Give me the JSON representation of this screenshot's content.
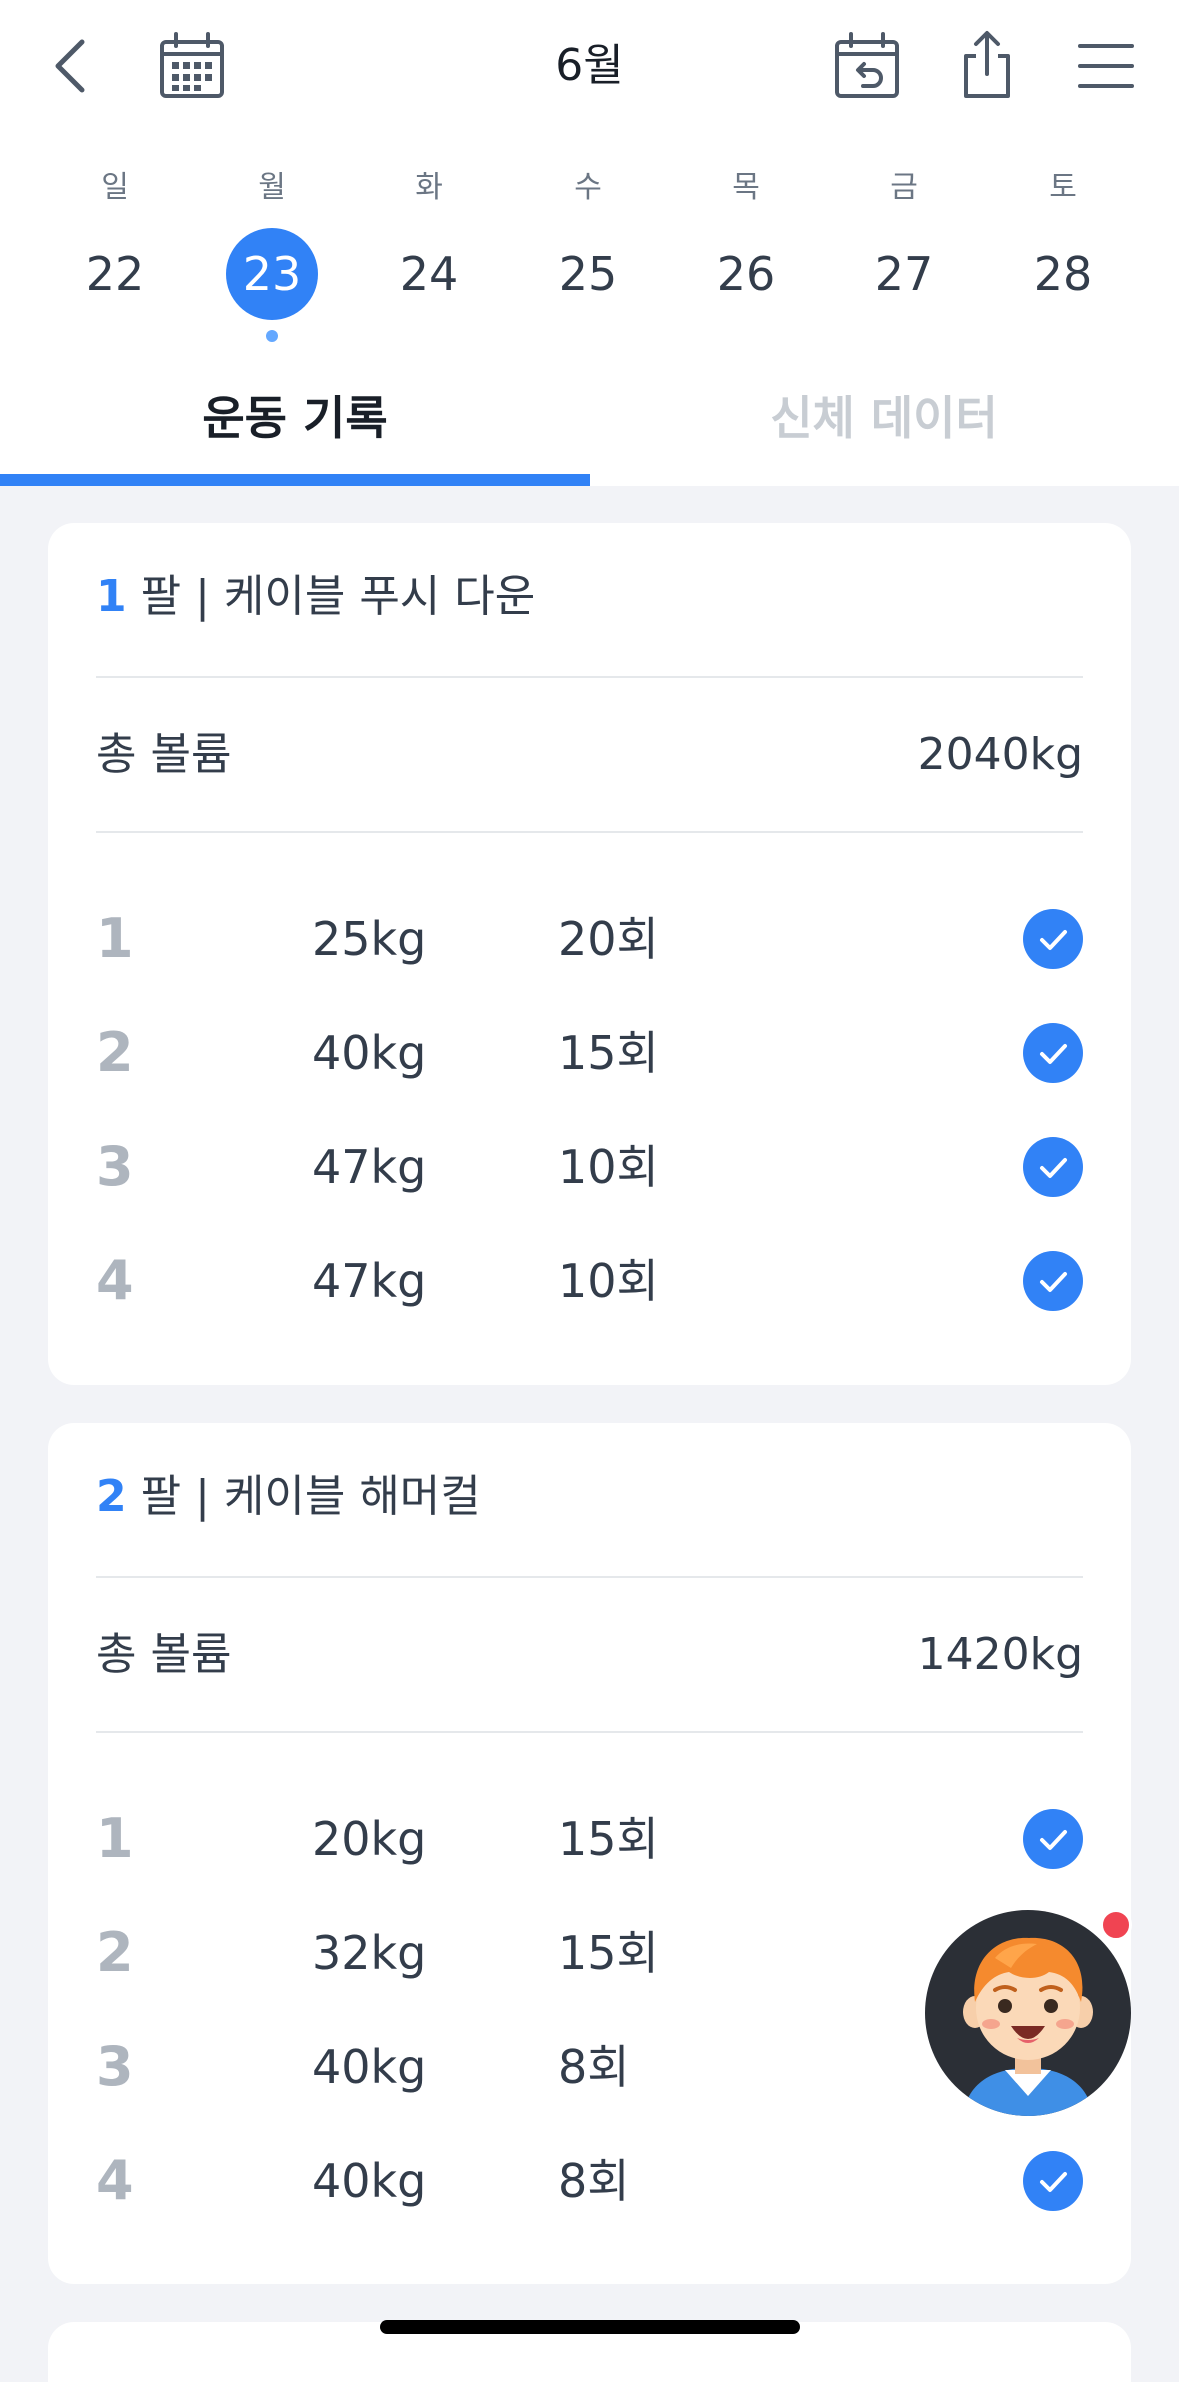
{
  "header": {
    "month_title": "6월",
    "icons": [
      "back-icon",
      "calendar-icon",
      "calendar-undo-icon",
      "share-icon",
      "menu-icon"
    ]
  },
  "week": {
    "days": [
      {
        "dow": "일",
        "num": "22"
      },
      {
        "dow": "월",
        "num": "23",
        "selected": true,
        "has_record": true
      },
      {
        "dow": "화",
        "num": "24"
      },
      {
        "dow": "수",
        "num": "25"
      },
      {
        "dow": "목",
        "num": "26"
      },
      {
        "dow": "금",
        "num": "27"
      },
      {
        "dow": "토",
        "num": "28"
      }
    ]
  },
  "tabs": {
    "active": "운동 기록",
    "inactive": "신체 데이터"
  },
  "exercises": [
    {
      "index": "1",
      "title": "팔 | 케이블 푸시 다운",
      "volume_label": "총 볼륨",
      "volume_value": "2040kg",
      "sets": [
        {
          "num": "1",
          "weight": "25kg",
          "reps": "20회",
          "done": true
        },
        {
          "num": "2",
          "weight": "40kg",
          "reps": "15회",
          "done": true
        },
        {
          "num": "3",
          "weight": "47kg",
          "reps": "10회",
          "done": true
        },
        {
          "num": "4",
          "weight": "47kg",
          "reps": "10회",
          "done": true
        }
      ]
    },
    {
      "index": "2",
      "title": "팔 | 케이블 해머컬",
      "volume_label": "총 볼륨",
      "volume_value": "1420kg",
      "sets": [
        {
          "num": "1",
          "weight": "20kg",
          "reps": "15회",
          "done": true
        },
        {
          "num": "2",
          "weight": "32kg",
          "reps": "15회",
          "done": true
        },
        {
          "num": "3",
          "weight": "40kg",
          "reps": "8회",
          "done": true
        },
        {
          "num": "4",
          "weight": "40kg",
          "reps": "8회",
          "done": true
        }
      ]
    }
  ],
  "colors": {
    "accent": "#3182f6",
    "background": "#f2f3f7",
    "badge": "#f04452"
  }
}
